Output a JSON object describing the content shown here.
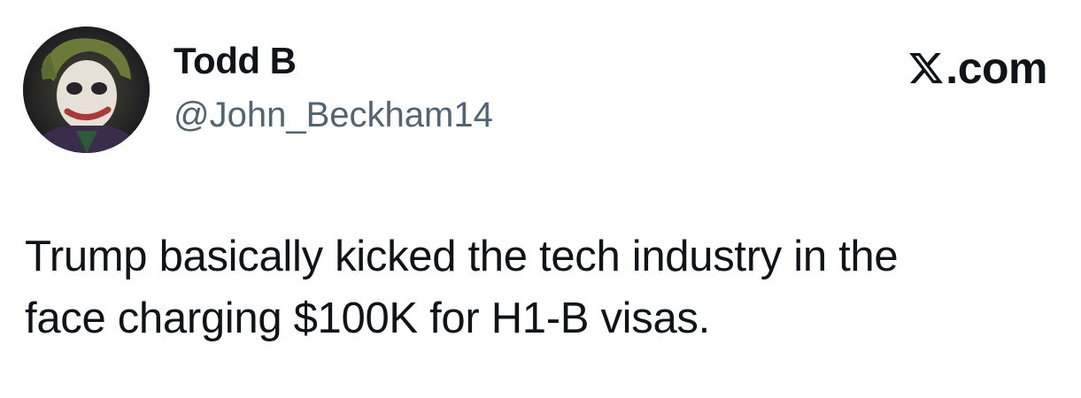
{
  "author": {
    "display_name": "Todd B",
    "handle": "@John_Beckham14",
    "avatar_icon": "avatar-photo"
  },
  "brand": {
    "icon": "x-logo-icon",
    "text": ".com"
  },
  "tweet": {
    "lines": [
      "Trump basically kicked the tech industry in the",
      "face charging $100K for H1-B visas."
    ]
  }
}
